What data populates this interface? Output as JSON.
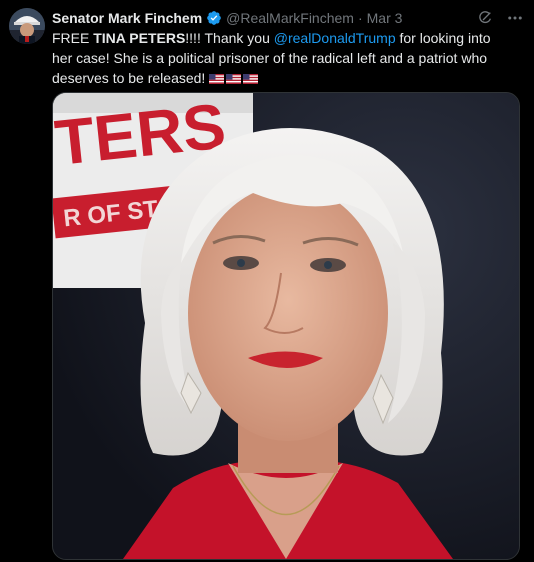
{
  "author": {
    "display_name": "Senator Mark Finchem",
    "handle": "@RealMarkFinchem",
    "separator": "·",
    "date": "Mar 3",
    "verified": true
  },
  "post": {
    "segments": [
      {
        "text": "FREE ",
        "style": "normal"
      },
      {
        "text": "TINA PETERS",
        "style": "bold"
      },
      {
        "text": "!!!! Thank you ",
        "style": "normal"
      },
      {
        "text": "@realDonaldTrump",
        "style": "mention"
      },
      {
        "text": " for looking into her case! She is a political prisoner of the radical left and a patriot who deserves to be released! ",
        "style": "normal"
      }
    ],
    "emoji": [
      "us-flag",
      "us-flag",
      "us-flag"
    ]
  },
  "media": {
    "background_sign_text": "TERS",
    "background_sign_subtext": "R OF ST"
  },
  "icons": {
    "verified": "verified-badge-icon",
    "grok": "grok-icon",
    "more": "more-icon"
  },
  "colors": {
    "background": "#000000",
    "text": "#e7e9ea",
    "muted": "#71767b",
    "link": "#1d9bf0",
    "verified": "#1d9bf0",
    "jacket": "#c4122a"
  }
}
